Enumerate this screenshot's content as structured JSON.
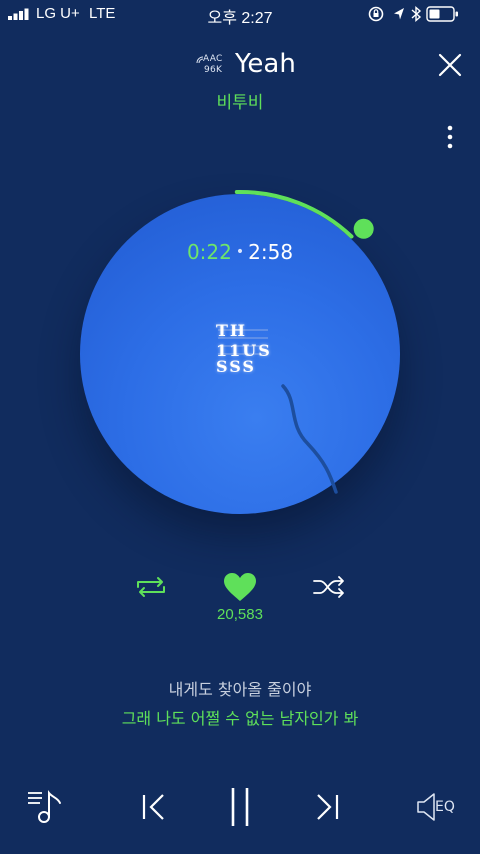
{
  "status_bar": {
    "carrier": "LG U+",
    "network": "LTE",
    "time": "오후 2:27"
  },
  "track": {
    "codec_line1": "AAC",
    "codec_line2": "96K",
    "title": "Yeah",
    "artist": "비투비"
  },
  "playback": {
    "current_time": "0:22",
    "separator": "•",
    "total_time": "2:58",
    "progress": 0.124
  },
  "album_logo": {
    "row1": "TH",
    "row2": "11US",
    "row3": "SSS"
  },
  "actions": {
    "like_count": "20,583"
  },
  "lyrics": {
    "previous_line": "내게도 찾아올 줄이야",
    "current_line": "그래 나도 어쩔 수 없는 남자인가 봐"
  },
  "controls": {
    "eq_label": "EQ"
  },
  "colors": {
    "background": "#112c5e",
    "accent_green": "#5fe05a",
    "disc_blue": "#2d6ee6"
  },
  "icons": {
    "close": "close-icon",
    "more": "more-vertical-icon",
    "repeat": "repeat-icon",
    "heart": "heart-icon",
    "shuffle": "shuffle-icon",
    "playlist": "playlist-icon",
    "previous": "previous-track-icon",
    "pause": "pause-icon",
    "next": "next-track-icon",
    "equalizer": "equalizer-icon"
  }
}
